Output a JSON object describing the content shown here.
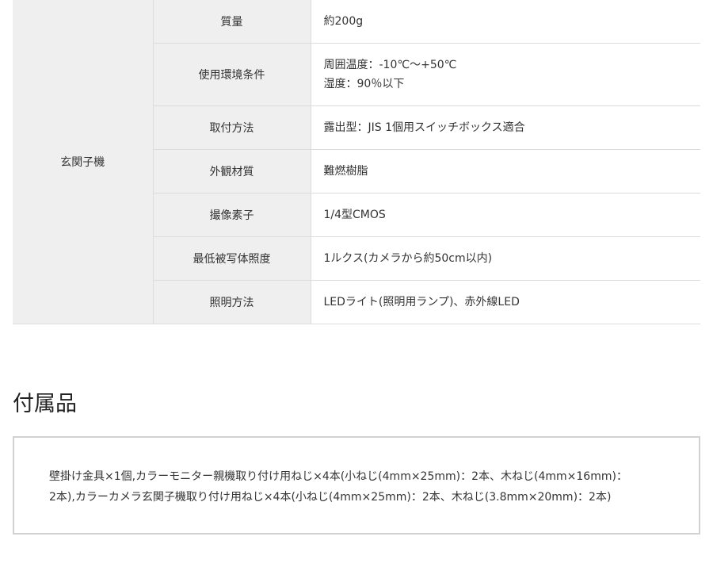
{
  "spec": {
    "group_label": "玄関子機",
    "rows": [
      {
        "label": "質量",
        "values": [
          "約200g"
        ]
      },
      {
        "label": "使用環境条件",
        "values": [
          "周囲温度：-10℃～+50℃",
          "湿度：90％以下"
        ]
      },
      {
        "label": "取付方法",
        "values": [
          "露出型：JIS 1個用スイッチボックス適合"
        ]
      },
      {
        "label": "外観材質",
        "values": [
          "難燃樹脂"
        ]
      },
      {
        "label": "撮像素子",
        "values": [
          "1/4型CMOS"
        ]
      },
      {
        "label": "最低被写体照度",
        "values": [
          "1ルクス(カメラから約50cm以内)"
        ]
      },
      {
        "label": "照明方法",
        "values": [
          "LEDライト(照明用ランプ)、赤外線LED"
        ]
      }
    ]
  },
  "accessories": {
    "title": "付属品",
    "line1": "壁掛け金具×1個,カラーモニター親機取り付け用ねじ×4本(小ねじ(4mm×25mm)：2本、木ねじ(4mm×16mm)：",
    "line2": "2本),カラーカメラ玄関子機取り付け用ねじ×4本(小ねじ(4mm×25mm)：2本、木ねじ(3.8mm×20mm)：2本)"
  }
}
